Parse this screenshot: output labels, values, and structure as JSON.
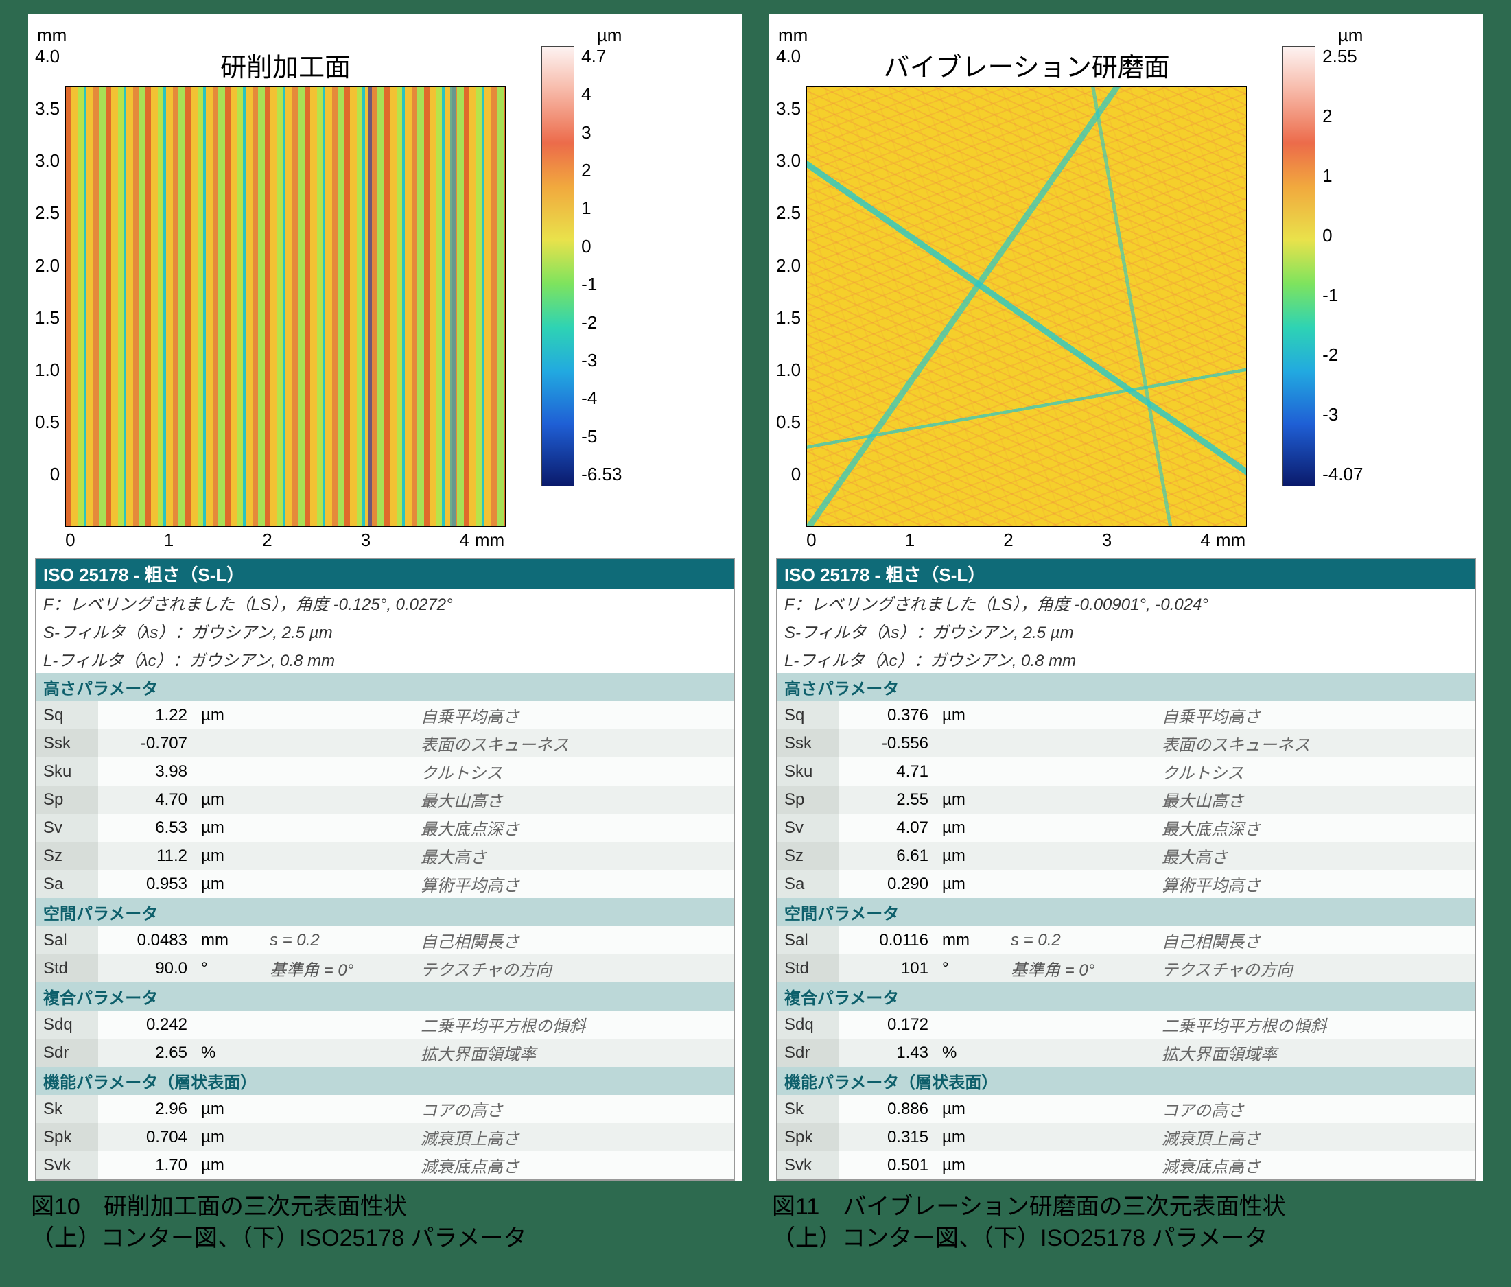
{
  "left": {
    "plot": {
      "title": "研削加工面",
      "y_unit": "mm",
      "x_unit": "mm",
      "cb_unit": "µm",
      "yticks": [
        "4.0",
        "3.5",
        "3.0",
        "2.5",
        "2.0",
        "1.5",
        "1.0",
        "0.5",
        "0"
      ],
      "xticks": [
        "0",
        "1",
        "2",
        "3",
        "4"
      ],
      "cbticks": [
        "4.7",
        "4",
        "3",
        "2",
        "1",
        "0",
        "-1",
        "-2",
        "-3",
        "-4",
        "-5",
        "-6.53"
      ]
    },
    "table": {
      "title": "ISO 25178 - 粗さ（S-L）",
      "filters": [
        "F：レベリングされました（LS），角度 -0.125°, 0.0272°",
        "S-フィルタ（λs）：ガウシアン, 2.5 µm",
        "L-フィルタ（λc）：ガウシアン, 0.8 mm"
      ],
      "sections": [
        {
          "name": "高さパラメータ",
          "rows": [
            {
              "sym": "Sq",
              "val": "1.22",
              "unit": "µm",
              "cond": "",
              "desc": "自乗平均高さ"
            },
            {
              "sym": "Ssk",
              "val": "-0.707",
              "unit": "",
              "cond": "",
              "desc": "表面のスキューネス"
            },
            {
              "sym": "Sku",
              "val": "3.98",
              "unit": "",
              "cond": "",
              "desc": "クルトシス"
            },
            {
              "sym": "Sp",
              "val": "4.70",
              "unit": "µm",
              "cond": "",
              "desc": "最大山高さ"
            },
            {
              "sym": "Sv",
              "val": "6.53",
              "unit": "µm",
              "cond": "",
              "desc": "最大底点深さ"
            },
            {
              "sym": "Sz",
              "val": "11.2",
              "unit": "µm",
              "cond": "",
              "desc": "最大高さ"
            },
            {
              "sym": "Sa",
              "val": "0.953",
              "unit": "µm",
              "cond": "",
              "desc": "算術平均高さ"
            }
          ]
        },
        {
          "name": "空間パラメータ",
          "rows": [
            {
              "sym": "Sal",
              "val": "0.0483",
              "unit": "mm",
              "cond": "s = 0.2",
              "desc": "自己相関長さ"
            },
            {
              "sym": "Std",
              "val": "90.0",
              "unit": "°",
              "cond": "基準角 = 0°",
              "desc": "テクスチャの方向"
            }
          ]
        },
        {
          "name": "複合パラメータ",
          "rows": [
            {
              "sym": "Sdq",
              "val": "0.242",
              "unit": "",
              "cond": "",
              "desc": "二乗平均平方根の傾斜"
            },
            {
              "sym": "Sdr",
              "val": "2.65",
              "unit": "%",
              "cond": "",
              "desc": "拡大界面領域率"
            }
          ]
        },
        {
          "name": "機能パラメータ（層状表面）",
          "rows": [
            {
              "sym": "Sk",
              "val": "2.96",
              "unit": "µm",
              "cond": "",
              "desc": "コアの高さ"
            },
            {
              "sym": "Spk",
              "val": "0.704",
              "unit": "µm",
              "cond": "",
              "desc": "減衰頂上高さ"
            },
            {
              "sym": "Svk",
              "val": "1.70",
              "unit": "µm",
              "cond": "",
              "desc": "減衰底点高さ"
            }
          ]
        }
      ]
    },
    "caption_line1": "図10　研削加工面の三次元表面性状",
    "caption_line2": "（上）コンター図、（下）ISO25178 パラメータ"
  },
  "right": {
    "plot": {
      "title": "バイブレーション研磨面",
      "y_unit": "mm",
      "x_unit": "mm",
      "cb_unit": "µm",
      "yticks": [
        "4.0",
        "3.5",
        "3.0",
        "2.5",
        "2.0",
        "1.5",
        "1.0",
        "0.5",
        "0"
      ],
      "xticks": [
        "0",
        "1",
        "2",
        "3",
        "4"
      ],
      "cbticks": [
        "2.55",
        "2",
        "1",
        "0",
        "-1",
        "-2",
        "-3",
        "-4.07"
      ]
    },
    "table": {
      "title": "ISO 25178 - 粗さ（S-L）",
      "filters": [
        "F：レベリングされました（LS），角度 -0.00901°, -0.024°",
        "S-フィルタ（λs）：ガウシアン, 2.5 µm",
        "L-フィルタ（λc）：ガウシアン, 0.8 mm"
      ],
      "sections": [
        {
          "name": "高さパラメータ",
          "rows": [
            {
              "sym": "Sq",
              "val": "0.376",
              "unit": "µm",
              "cond": "",
              "desc": "自乗平均高さ"
            },
            {
              "sym": "Ssk",
              "val": "-0.556",
              "unit": "",
              "cond": "",
              "desc": "表面のスキューネス"
            },
            {
              "sym": "Sku",
              "val": "4.71",
              "unit": "",
              "cond": "",
              "desc": "クルトシス"
            },
            {
              "sym": "Sp",
              "val": "2.55",
              "unit": "µm",
              "cond": "",
              "desc": "最大山高さ"
            },
            {
              "sym": "Sv",
              "val": "4.07",
              "unit": "µm",
              "cond": "",
              "desc": "最大底点深さ"
            },
            {
              "sym": "Sz",
              "val": "6.61",
              "unit": "µm",
              "cond": "",
              "desc": "最大高さ"
            },
            {
              "sym": "Sa",
              "val": "0.290",
              "unit": "µm",
              "cond": "",
              "desc": "算術平均高さ"
            }
          ]
        },
        {
          "name": "空間パラメータ",
          "rows": [
            {
              "sym": "Sal",
              "val": "0.0116",
              "unit": "mm",
              "cond": "s = 0.2",
              "desc": "自己相関長さ"
            },
            {
              "sym": "Std",
              "val": "101",
              "unit": "°",
              "cond": "基準角 = 0°",
              "desc": "テクスチャの方向"
            }
          ]
        },
        {
          "name": "複合パラメータ",
          "rows": [
            {
              "sym": "Sdq",
              "val": "0.172",
              "unit": "",
              "cond": "",
              "desc": "二乗平均平方根の傾斜"
            },
            {
              "sym": "Sdr",
              "val": "1.43",
              "unit": "%",
              "cond": "",
              "desc": "拡大界面領域率"
            }
          ]
        },
        {
          "name": "機能パラメータ（層状表面）",
          "rows": [
            {
              "sym": "Sk",
              "val": "0.886",
              "unit": "µm",
              "cond": "",
              "desc": "コアの高さ"
            },
            {
              "sym": "Spk",
              "val": "0.315",
              "unit": "µm",
              "cond": "",
              "desc": "減衰頂上高さ"
            },
            {
              "sym": "Svk",
              "val": "0.501",
              "unit": "µm",
              "cond": "",
              "desc": "減衰底点高さ"
            }
          ]
        }
      ]
    },
    "caption_line1": "図11　バイブレーション研磨面の三次元表面性状",
    "caption_line2": "（上）コンター図、（下）ISO25178 パラメータ"
  },
  "chart_data": [
    {
      "type": "heatmap",
      "title": "研削加工面",
      "xlabel": "mm",
      "ylabel": "mm",
      "xlim": [
        0,
        4
      ],
      "ylim": [
        0,
        4
      ],
      "zunit": "µm",
      "zlim": [
        -6.53,
        4.7
      ],
      "note": "vertically-striated grinding surface contour; dominant texture direction Std=90°"
    },
    {
      "type": "heatmap",
      "title": "バイブレーション研磨面",
      "xlabel": "mm",
      "ylabel": "mm",
      "xlim": [
        0,
        4
      ],
      "ylim": [
        0,
        4
      ],
      "zunit": "µm",
      "zlim": [
        -4.07,
        2.55
      ],
      "note": "random cross-hatch vibration-polish surface contour; Std≈101°"
    }
  ]
}
